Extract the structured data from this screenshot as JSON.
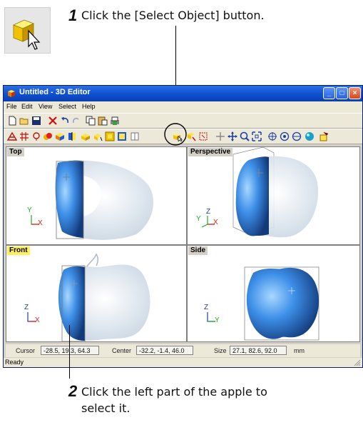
{
  "steps": [
    {
      "number": "1",
      "text": "Click the [Select Object] button."
    },
    {
      "number": "2",
      "line1": "Click the left part of the apple to",
      "line2": "select it."
    }
  ],
  "window": {
    "title": "Untitled - 3D Editor",
    "controls": {
      "minimize": "_",
      "maximize": "□",
      "close": "×"
    }
  },
  "menu": [
    "File",
    "Edit",
    "View",
    "Select",
    "Help"
  ],
  "viewports": {
    "top": "Top",
    "perspective": "Perspective",
    "front": "Front",
    "side": "Side"
  },
  "axes": {
    "top": {
      "v": "Y",
      "h": "X"
    },
    "perspective": {
      "v": "Z",
      "h": "X",
      "d": "Y"
    },
    "front": {
      "v": "Z",
      "h": "X"
    },
    "side": {
      "v": "Z",
      "h": "Y"
    }
  },
  "status": {
    "cursor_label": "Cursor",
    "cursor_value": "-28.5, 19.3, 64.3",
    "center_label": "Center",
    "center_value": "-32.2, -1.4, 46.0",
    "size_label": "Size",
    "size_value": "27.1, 82.6, 92.0",
    "unit": "mm",
    "ready": "Ready"
  },
  "colors": {
    "title_bar": "#1a5ad8",
    "active_label": "#ffef5a",
    "axis_red": "#e02020",
    "axis_green": "#22aa22",
    "apple_blue": "#2d6fd8"
  }
}
